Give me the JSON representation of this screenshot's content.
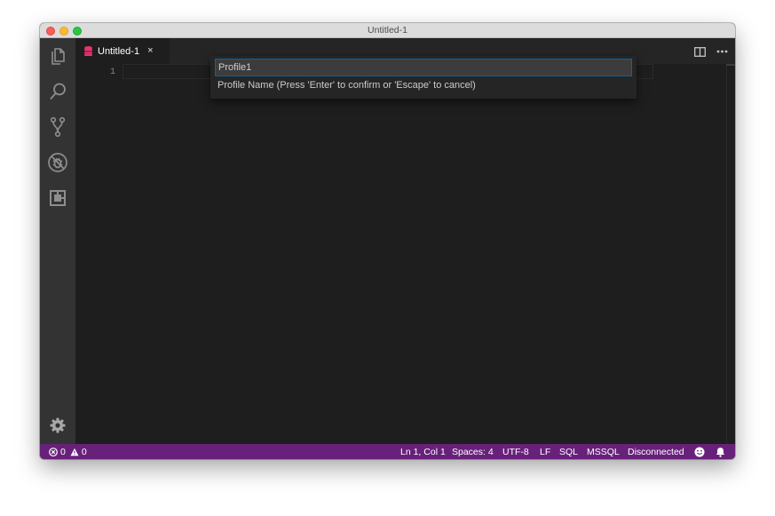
{
  "window": {
    "title": "Untitled-1"
  },
  "activity_bar": {
    "items": [
      "explorer-icon",
      "search-icon",
      "source-control-icon",
      "debug-icon",
      "extensions-icon"
    ],
    "bottom": "settings-gear-icon"
  },
  "tabs": [
    {
      "label": "Untitled-1",
      "icon": "database-icon",
      "close": "×"
    }
  ],
  "tab_actions": [
    "split-editor-icon",
    "more-actions-icon"
  ],
  "editor": {
    "line_numbers": [
      "1"
    ]
  },
  "quick_input": {
    "value": "Profile1",
    "message": "Profile Name (Press 'Enter' to confirm or 'Escape' to cancel)"
  },
  "status_bar": {
    "errors": "0",
    "warnings": "0",
    "position": "Ln 1, Col 1",
    "indentation": "Spaces: 4",
    "encoding": "UTF-8",
    "eol": "LF",
    "language": "SQL",
    "provider": "MSSQL",
    "connection": "Disconnected"
  },
  "colors": {
    "status_bar": "#68217a",
    "editor_background": "#1e1e1e",
    "activity_bar": "#333333",
    "tab_icon": "#e8356e",
    "input_focus_border": "#0e639c"
  }
}
